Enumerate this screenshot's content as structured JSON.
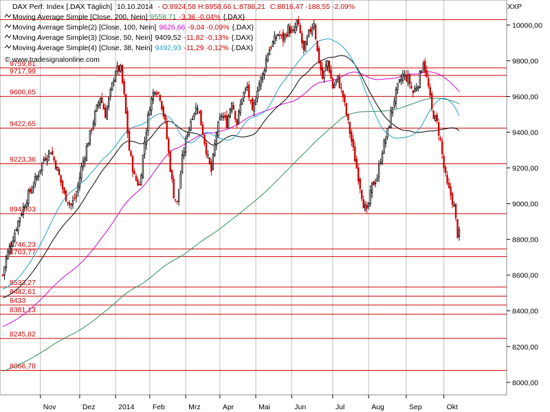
{
  "header": {
    "title_prefix": "DAX Perf. Index [.DAX Täglich]",
    "date": "10.10.2014",
    "ohlc": "- O:8924,58 H:8958,66 L:8788,21",
    "close_change": "C:8816,47 -188,55 -2,09%",
    "xxp": "XXP",
    "source": "© www.tradesignalonline.com"
  },
  "legend": [
    {
      "label": "Moving Average Simple [Close, 200, Nein]",
      "value": "9558,71",
      "change": "-3,36 -0,04% {.DAX}",
      "color": "#2e8b57"
    },
    {
      "label": "Moving Average Simple(2) [Close, 100, Nein]",
      "value": "9626,66",
      "change": "-9,04 -0,09% {.DAX}",
      "color": "#cc00cc"
    },
    {
      "label": "Moving Average Simple(3) [Close, 50, Nein]",
      "value": "9409,52",
      "change": "-11,82 -0,13% {.DAX}",
      "color": "#000000"
    },
    {
      "label": "Moving Average Simple(4) [Close, 38, Nein]",
      "value": "9492,93",
      "change": "-11,29 -0,12% {.DAX}",
      "color": "#1e9ec8"
    }
  ],
  "chart_data": {
    "type": "candlestick",
    "y_axis_label": "",
    "ylim": [
      7930,
      10140
    ],
    "y_ticks": [
      {
        "value": 10000,
        "label": "10000,00"
      },
      {
        "value": 9800,
        "label": "9800,00"
      },
      {
        "value": 9600,
        "label": "9600,00"
      },
      {
        "value": 9400,
        "label": "9400,00"
      },
      {
        "value": 9200,
        "label": "9200,00"
      },
      {
        "value": 9000,
        "label": "9000,00"
      },
      {
        "value": 8800,
        "label": "8800,00"
      },
      {
        "value": 8600,
        "label": "8600,00"
      },
      {
        "value": 8400,
        "label": "8400,00"
      },
      {
        "value": 8200,
        "label": "8200,00"
      },
      {
        "value": 8000,
        "label": "8000,00"
      }
    ],
    "x_ticks": [
      {
        "label": "Nov",
        "month_index": 1
      },
      {
        "label": "Dez",
        "month_index": 2
      },
      {
        "label": "2014",
        "month_index": 3
      },
      {
        "label": "Feb",
        "month_index": 4
      },
      {
        "label": "Mrz",
        "month_index": 5
      },
      {
        "label": "Apr",
        "month_index": 6
      },
      {
        "label": "Mai",
        "month_index": 7
      },
      {
        "label": "Jun",
        "month_index": 8
      },
      {
        "label": "Jul",
        "month_index": 9
      },
      {
        "label": "Aug",
        "month_index": 10
      },
      {
        "label": "Sep",
        "month_index": 11
      },
      {
        "label": "Okt",
        "month_index": 12
      }
    ],
    "levels": [
      {
        "label": "",
        "value": 10030
      },
      {
        "label": "9759,81",
        "value": 9759.81
      },
      {
        "label": "9717,99",
        "value": 9717.99
      },
      {
        "label": "9600,65",
        "value": 9600.65
      },
      {
        "label": "9422,65",
        "value": 9422.65
      },
      {
        "label": "9223,36",
        "value": 9223.36
      },
      {
        "label": "8944,03",
        "value": 8944.03
      },
      {
        "label": "8746,23",
        "value": 8746.23
      },
      {
        "label": "8703,77",
        "value": 8703.77
      },
      {
        "label": "8533,27",
        "value": 8533.27
      },
      {
        "label": "8482,61",
        "value": 8482.61
      },
      {
        "label": "8433",
        "value": 8433
      },
      {
        "label": "8381,13",
        "value": 8381.13
      },
      {
        "label": "8245,82",
        "value": 8245.82
      },
      {
        "label": "8066,78",
        "value": 8066.78
      }
    ],
    "price_anchors": [
      [
        0,
        8600
      ],
      [
        2,
        8700
      ],
      [
        5,
        8780
      ],
      [
        10,
        8930
      ],
      [
        15,
        9050
      ],
      [
        20,
        9150
      ],
      [
        24,
        9250
      ],
      [
        28,
        9300
      ],
      [
        32,
        9190
      ],
      [
        36,
        9050
      ],
      [
        40,
        8990
      ],
      [
        43,
        9050
      ],
      [
        46,
        9200
      ],
      [
        50,
        9350
      ],
      [
        54,
        9500
      ],
      [
        57,
        9600
      ],
      [
        60,
        9500
      ],
      [
        63,
        9620
      ],
      [
        66,
        9750
      ],
      [
        69,
        9750
      ],
      [
        71,
        9600
      ],
      [
        74,
        9300
      ],
      [
        77,
        9150
      ],
      [
        80,
        9100
      ],
      [
        83,
        9350
      ],
      [
        86,
        9550
      ],
      [
        89,
        9650
      ],
      [
        92,
        9600
      ],
      [
        95,
        9450
      ],
      [
        98,
        9200
      ],
      [
        100,
        9050
      ],
      [
        102,
        9000
      ],
      [
        105,
        9250
      ],
      [
        108,
        9400
      ],
      [
        111,
        9500
      ],
      [
        114,
        9550
      ],
      [
        117,
        9400
      ],
      [
        120,
        9250
      ],
      [
        122,
        9180
      ],
      [
        125,
        9400
      ],
      [
        128,
        9500
      ],
      [
        131,
        9450
      ],
      [
        134,
        9580
      ],
      [
        137,
        9450
      ],
      [
        140,
        9600
      ],
      [
        143,
        9650
      ],
      [
        146,
        9500
      ],
      [
        149,
        9650
      ],
      [
        152,
        9720
      ],
      [
        155,
        9850
      ],
      [
        158,
        9900
      ],
      [
        161,
        9950
      ],
      [
        164,
        9920
      ],
      [
        167,
        9980
      ],
      [
        170,
        9950
      ],
      [
        172,
        10020
      ],
      [
        174,
        9950
      ],
      [
        176,
        9850
      ],
      [
        179,
        9950
      ],
      [
        182,
        10020
      ],
      [
        184,
        9850
      ],
      [
        187,
        9700
      ],
      [
        190,
        9800
      ],
      [
        193,
        9650
      ],
      [
        196,
        9700
      ],
      [
        199,
        9600
      ],
      [
        202,
        9450
      ],
      [
        205,
        9300
      ],
      [
        208,
        9150
      ],
      [
        211,
        9000
      ],
      [
        213,
        8950
      ],
      [
        216,
        9100
      ],
      [
        219,
        9150
      ],
      [
        222,
        9300
      ],
      [
        225,
        9400
      ],
      [
        228,
        9550
      ],
      [
        231,
        9650
      ],
      [
        234,
        9720
      ],
      [
        237,
        9700
      ],
      [
        240,
        9620
      ],
      [
        243,
        9680
      ],
      [
        246,
        9800
      ],
      [
        249,
        9650
      ],
      [
        251,
        9520
      ],
      [
        254,
        9450
      ],
      [
        256,
        9350
      ],
      [
        258,
        9200
      ],
      [
        260,
        9100
      ],
      [
        262,
        9050
      ],
      [
        264,
        8980
      ],
      [
        266,
        8830
      ]
    ],
    "n_days": 268,
    "sma200_start": 8060,
    "sma100_start": 8310,
    "sma50_start": 8470,
    "sma38_start": 8520,
    "sma200_last": 9558.71,
    "sma100_last": 9626.66,
    "sma50_last": 9409.52,
    "sma38_last": 9492.93
  }
}
